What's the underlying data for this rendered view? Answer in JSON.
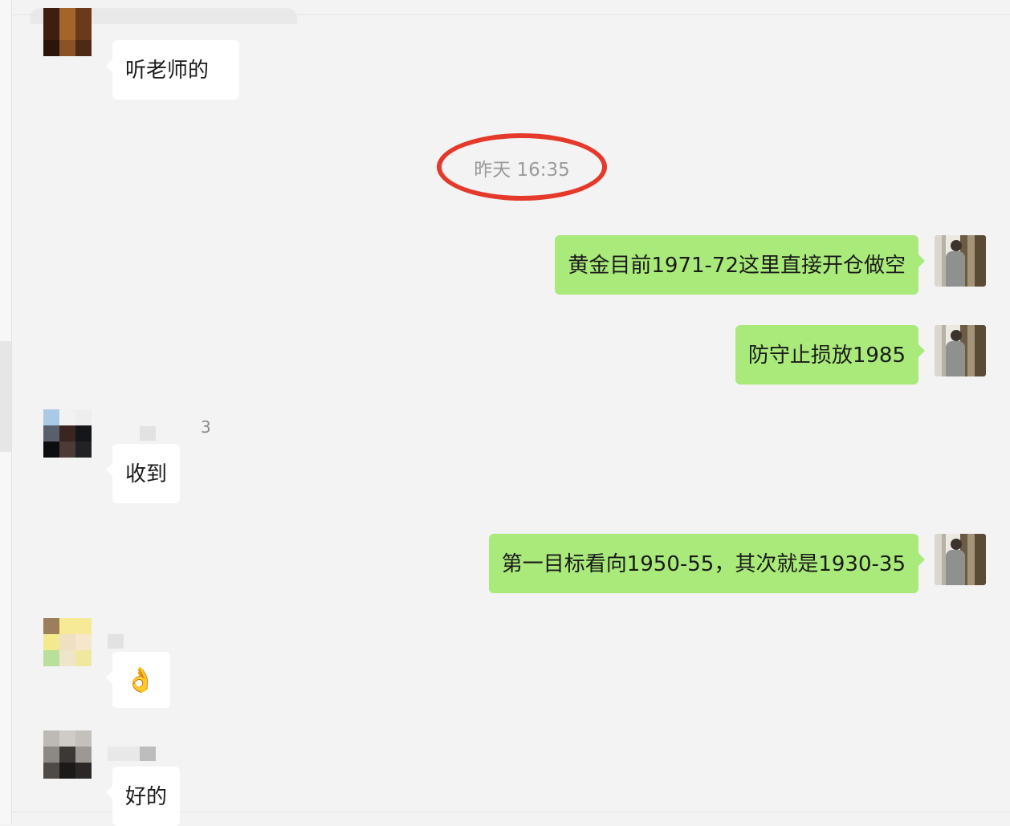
{
  "messages": [
    {
      "side": "incoming",
      "text": "听老师的"
    },
    {
      "side": "system",
      "text": "昨天 16:35"
    },
    {
      "side": "outgoing",
      "text": "黄金目前1971-72这里直接开仓做空"
    },
    {
      "side": "outgoing",
      "text": "防守止损放1985"
    },
    {
      "side": "incoming",
      "text": "收到"
    },
    {
      "side": "outgoing",
      "text": "第一目标看向1950-55，其次就是1930-35"
    },
    {
      "side": "incoming",
      "text": "👌"
    },
    {
      "side": "incoming",
      "text": "好的"
    }
  ],
  "fragments": {
    "partial_digit": "3"
  },
  "colors": {
    "outgoing_bubble": "#a9ea7a",
    "incoming_bubble": "#ffffff",
    "timestamp_highlight": "#e53a2b",
    "background": "#f3f3f3"
  }
}
